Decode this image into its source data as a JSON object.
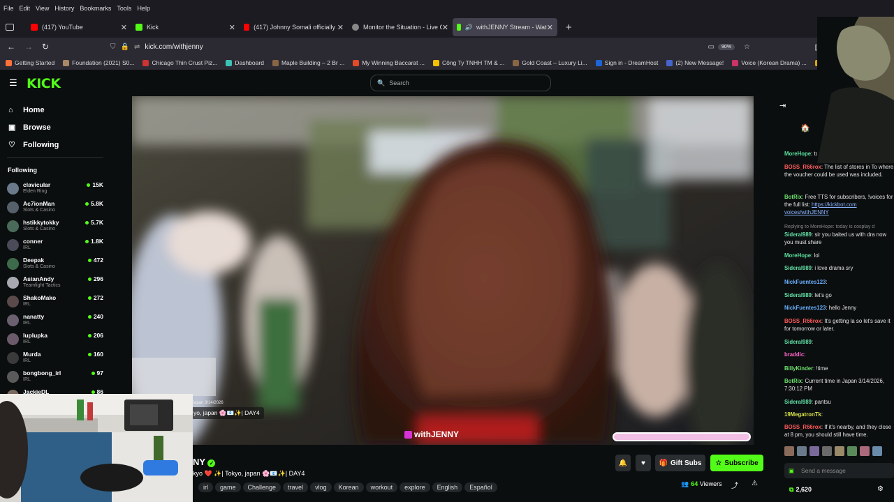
{
  "menubar": {
    "items": [
      "File",
      "Edit",
      "View",
      "History",
      "Bookmarks",
      "Tools",
      "Help"
    ]
  },
  "tabs": [
    {
      "label": "(417) YouTube",
      "color": "#ff0000"
    },
    {
      "label": "Kick",
      "color": "#53fc18"
    },
    {
      "label": "(417) Johnny Somali officially Ja",
      "color": "#ff0000"
    },
    {
      "label": "Monitor the Situation - Live Gl",
      "color": "#888888"
    },
    {
      "label": "withJENNY Stream - Watch",
      "color": "#53fc18"
    }
  ],
  "nav": {
    "url": "kick.com/withjenny",
    "zoom": "90%"
  },
  "bookmarks": [
    {
      "label": "Getting Started",
      "color": "#ff7139"
    },
    {
      "label": "Foundation (2021) S0...",
      "color": "#aa8866"
    },
    {
      "label": "Chicago Thin Crust Piz...",
      "color": "#cc3333"
    },
    {
      "label": "Dashboard",
      "color": "#3cc3b6"
    },
    {
      "label": "Maple Building – 2 Br ...",
      "color": "#886644"
    },
    {
      "label": "My Winning Baccarat ...",
      "color": "#e34a2a"
    },
    {
      "label": "Công Ty TNHH TM & ...",
      "color": "#f2c100"
    },
    {
      "label": "Gold Coast – Luxury Li...",
      "color": "#886644"
    },
    {
      "label": "Sign in - DreamHost",
      "color": "#1e64d6"
    },
    {
      "label": "(2) New Message!",
      "color": "#4466cc"
    },
    {
      "label": "Voice (Korean Drama) ...",
      "color": "#cc3366"
    },
    {
      "label": "(1) New Message!",
      "color": "#e0a800"
    }
  ],
  "site": {
    "search_placeholder": "Search",
    "sidebar_nav": [
      {
        "label": "Home",
        "icon": "house-icon"
      },
      {
        "label": "Browse",
        "icon": "browse-icon"
      },
      {
        "label": "Following",
        "icon": "heart-icon"
      }
    ],
    "following_heading": "Following",
    "following": [
      {
        "name": "clavicular",
        "game": "Elden Ring",
        "viewers": "15K",
        "color": "#6a7a8a"
      },
      {
        "name": "Ac7ionMan",
        "game": "Slots & Casino",
        "viewers": "5.8K",
        "color": "#55606a"
      },
      {
        "name": "hstikkytokky",
        "game": "Slots & Casino",
        "viewers": "5.7K",
        "color": "#4a6a5a"
      },
      {
        "name": "conner",
        "game": "IRL",
        "viewers": "1.8K",
        "color": "#4a4a58"
      },
      {
        "name": "Deepak",
        "game": "Slots & Casino",
        "viewers": "472",
        "color": "#3d6a4a"
      },
      {
        "name": "AsianAndy",
        "game": "Teamfight Tactics",
        "viewers": "296",
        "color": "#a8a8b0"
      },
      {
        "name": "ShakoMako",
        "game": "IRL",
        "viewers": "272",
        "color": "#5a4a4a"
      },
      {
        "name": "nanatty",
        "game": "IRL",
        "viewers": "240",
        "color": "#6a6070"
      },
      {
        "name": "luplupka",
        "game": "IRL",
        "viewers": "206",
        "color": "#6a5a6a"
      },
      {
        "name": "Murda",
        "game": "IRL",
        "viewers": "160",
        "color": "#3a3a3a"
      },
      {
        "name": "bongbong_irl",
        "game": "IRL",
        "viewers": "97",
        "color": "#5a5a5a"
      },
      {
        "name": "JackieDL",
        "game": "",
        "viewers": "86",
        "color": "#7a6a60"
      }
    ],
    "stream": {
      "overlay_title": "yo, japan 🌸📧✨| DAY4",
      "overlay_date": "Japan 3/14/2026",
      "watermark": "withJENNY",
      "channel_suffix": "NY",
      "title": "kyo ❤️ ✨| Tokyo, japan 🌸📧✨| DAY4",
      "tags": [
        "irl",
        "game",
        "Challenge",
        "travel",
        "vlog",
        "Korean",
        "workout",
        "explore",
        "English",
        "Español"
      ],
      "viewers_count": "64",
      "viewers_label": "Viewers",
      "gift_label": "Gift Subs",
      "subscribe_label": "Subscribe"
    },
    "chat": {
      "messages": [
        {
          "user": "MoreHope",
          "user_color": "#5be3a0",
          "text": "today is cosplay day ?"
        },
        {
          "user": "BOSS_R66rox",
          "user_color": "#ff5c5c",
          "text": "The list of stores in To where the voucher could be used was included."
        },
        {
          "user": "BotRix",
          "user_color": "#6ee36e",
          "text": "Free TTS for subscribers, !voices for the full list:",
          "link": "https://kickbot.com voices/withJENNY"
        },
        {
          "user": "",
          "user_color": "#888888",
          "text": "Replying to MoreHope: today is cosplay d"
        },
        {
          "user": "Sideral989",
          "user_color": "#63e0a8",
          "text": "sir you baited us with dra now you must share"
        },
        {
          "user": "MoreHope",
          "user_color": "#5be3a0",
          "text": "lol"
        },
        {
          "user": "Sideral989",
          "user_color": "#63e0a8",
          "text": "i love drama sry"
        },
        {
          "user": "NickFuentes123",
          "user_color": "#6ab0ff",
          "text": ""
        },
        {
          "user": "Sideral989",
          "user_color": "#63e0a8",
          "text": "let's go"
        },
        {
          "user": "NickFuentes123",
          "user_color": "#6ab0ff",
          "text": "hello Jenny"
        },
        {
          "user": "BOSS_R66rox",
          "user_color": "#ff5c5c",
          "text": "It's getting la so let's save it for tomorrow or later."
        },
        {
          "user": "Sideral989",
          "user_color": "#63e0a8",
          "text": ""
        },
        {
          "user": "braddic",
          "user_color": "#ff66cc",
          "text": ""
        },
        {
          "user": "BillyKinder",
          "user_color": "#6ee36e",
          "text": "!time"
        },
        {
          "user": "BotRix",
          "user_color": "#6ee36e",
          "text": "Current time in Japan 3/14/2026, 7:30:12 PM"
        },
        {
          "user": "Sideral989",
          "user_color": "#63e0a8",
          "text": "pantsu"
        },
        {
          "user": "19MegatronTk",
          "user_color": "#d9e34a",
          "text": ""
        },
        {
          "user": "BOSS_R66rox",
          "user_color": "#ff5c5c",
          "text": "If it's nearby, and they close at 8 pm, you should still have time."
        }
      ],
      "send_placeholder": "Send a message",
      "points": "2,620"
    }
  }
}
